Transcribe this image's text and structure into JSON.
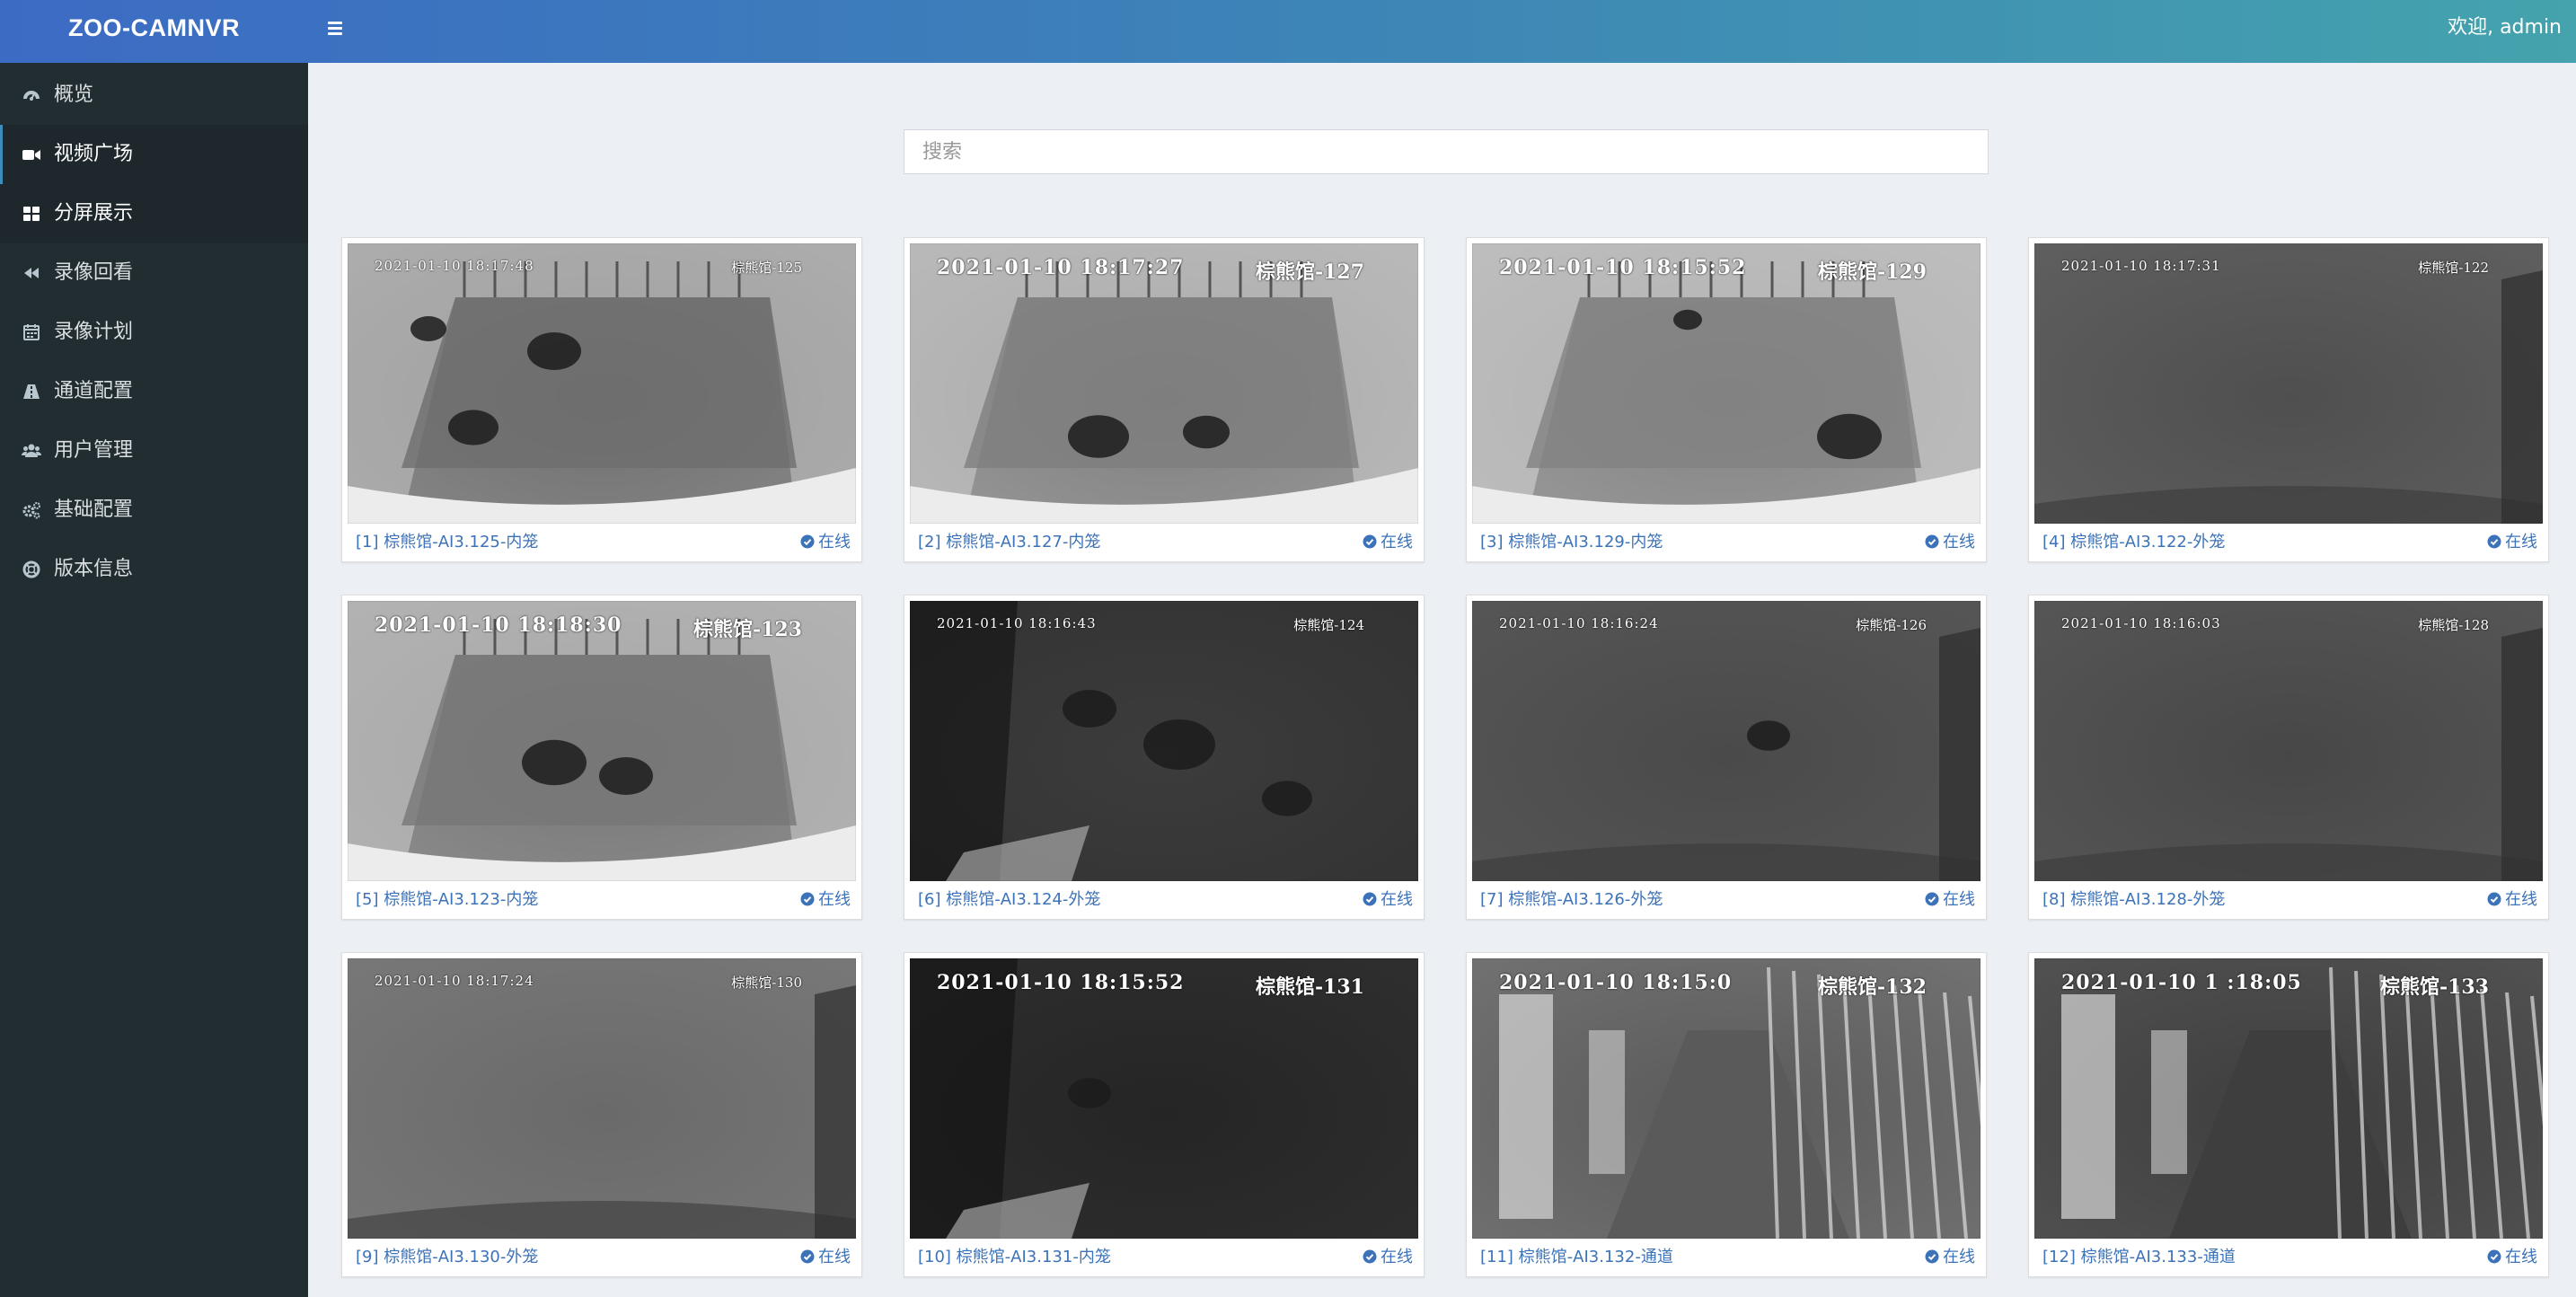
{
  "header": {
    "brand": "ZOO-CAMNVR",
    "welcome": "欢迎, admin"
  },
  "sidebar": {
    "items": [
      {
        "label": "概览",
        "icon": "dashboard-icon"
      },
      {
        "label": "视频广场",
        "icon": "video-camera-icon"
      },
      {
        "label": "分屏展示",
        "icon": "grid-icon"
      },
      {
        "label": "录像回看",
        "icon": "rewind-icon"
      },
      {
        "label": "录像计划",
        "icon": "calendar-icon"
      },
      {
        "label": "通道配置",
        "icon": "road-icon"
      },
      {
        "label": "用户管理",
        "icon": "users-icon"
      },
      {
        "label": "基础配置",
        "icon": "gears-icon"
      },
      {
        "label": "版本信息",
        "icon": "lifebuoy-icon"
      }
    ]
  },
  "search": {
    "placeholder": "搜索",
    "value": ""
  },
  "cameras": [
    {
      "caption": "[1] 棕熊馆-AI3.125-内笼",
      "status": "在线",
      "osd_time": "2021-01-10 18:17:48",
      "osd_name": "棕熊馆-125"
    },
    {
      "caption": "[2] 棕熊馆-AI3.127-内笼",
      "status": "在线",
      "osd_time": "2021-01-10 18:17:27",
      "osd_name": "棕熊馆-127"
    },
    {
      "caption": "[3] 棕熊馆-AI3.129-内笼",
      "status": "在线",
      "osd_time": "2021-01-10 18:15:52",
      "osd_name": "棕熊馆-129"
    },
    {
      "caption": "[4] 棕熊馆-AI3.122-外笼",
      "status": "在线",
      "osd_time": "2021-01-10 18:17:31",
      "osd_name": "棕熊馆-122"
    },
    {
      "caption": "[5] 棕熊馆-AI3.123-内笼",
      "status": "在线",
      "osd_time": "2021-01-10 18:18:30",
      "osd_name": "棕熊馆-123"
    },
    {
      "caption": "[6] 棕熊馆-AI3.124-外笼",
      "status": "在线",
      "osd_time": "2021-01-10 18:16:43",
      "osd_name": "棕熊馆-124"
    },
    {
      "caption": "[7] 棕熊馆-AI3.126-外笼",
      "status": "在线",
      "osd_time": "2021-01-10 18:16:24",
      "osd_name": "棕熊馆-126"
    },
    {
      "caption": "[8] 棕熊馆-AI3.128-外笼",
      "status": "在线",
      "osd_time": "2021-01-10 18:16:03",
      "osd_name": "棕熊馆-128"
    },
    {
      "caption": "[9] 棕熊馆-AI3.130-外笼",
      "status": "在线",
      "osd_time": "2021-01-10 18:17:24",
      "osd_name": "棕熊馆-130"
    },
    {
      "caption": "[10] 棕熊馆-AI3.131-内笼",
      "status": "在线",
      "osd_time": "2021-01-10 18:15:52",
      "osd_name": "棕熊馆-131"
    },
    {
      "caption": "[11] 棕熊馆-AI3.132-通道",
      "status": "在线",
      "osd_time": "2021-01-10 18:15:0",
      "osd_name": "棕熊馆-132"
    },
    {
      "caption": "[12] 棕熊馆-AI3.133-通道",
      "status": "在线",
      "osd_time": "2021-01-10 1 :18:05",
      "osd_name": "棕熊馆-133"
    }
  ],
  "colors": {
    "header_start": "#3c6bc4",
    "header_end": "#44a3ad",
    "sidebar_bg": "#222d32",
    "page_bg": "#ecf0f5",
    "link": "#3c73b8"
  }
}
